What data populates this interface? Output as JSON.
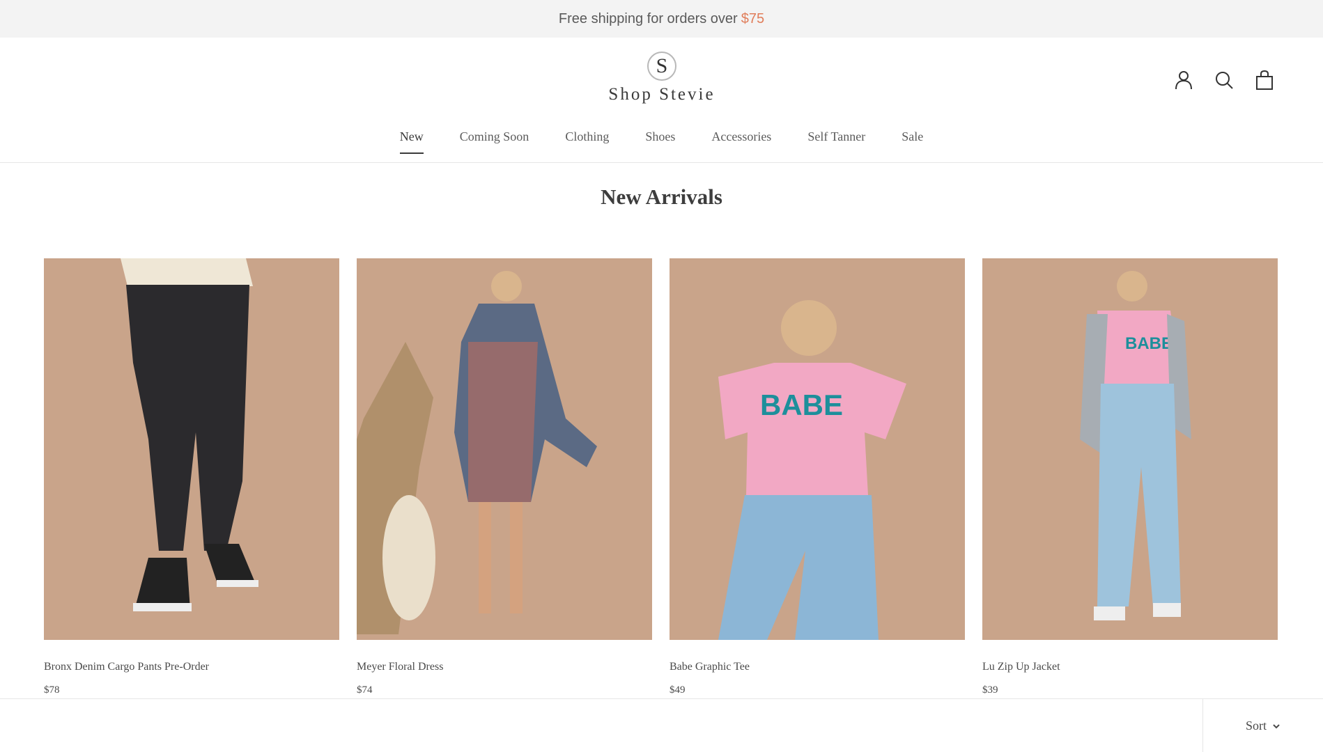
{
  "announcement": {
    "text": "Free shipping for orders over",
    "amount": "$75",
    "amount_color": "#e07d5a"
  },
  "brand": {
    "monogram": "S",
    "name": "Shop Stevie"
  },
  "header_icons": [
    "account-icon",
    "search-icon",
    "cart-icon"
  ],
  "nav": {
    "items": [
      {
        "label": "New",
        "active": true
      },
      {
        "label": "Coming Soon",
        "active": false
      },
      {
        "label": "Clothing",
        "active": false
      },
      {
        "label": "Shoes",
        "active": false
      },
      {
        "label": "Accessories",
        "active": false
      },
      {
        "label": "Self Tanner",
        "active": false
      },
      {
        "label": "Sale",
        "active": false
      }
    ]
  },
  "collection": {
    "title": "New Arrivals"
  },
  "products": [
    {
      "name": "Bronx Denim Cargo Pants Pre-Order",
      "price": "$78",
      "graphic": ""
    },
    {
      "name": "Meyer Floral Dress",
      "price": "$74",
      "graphic": ""
    },
    {
      "name": "Babe Graphic Tee",
      "price": "$49",
      "graphic": "BABE"
    },
    {
      "name": "Lu Zip Up Jacket",
      "price": "$39",
      "graphic": "BABE"
    }
  ],
  "toolbar": {
    "sort_label": "Sort"
  },
  "colors": {
    "photo_background": "#c9a48a",
    "announcement_bar": "#f3f3f3"
  }
}
